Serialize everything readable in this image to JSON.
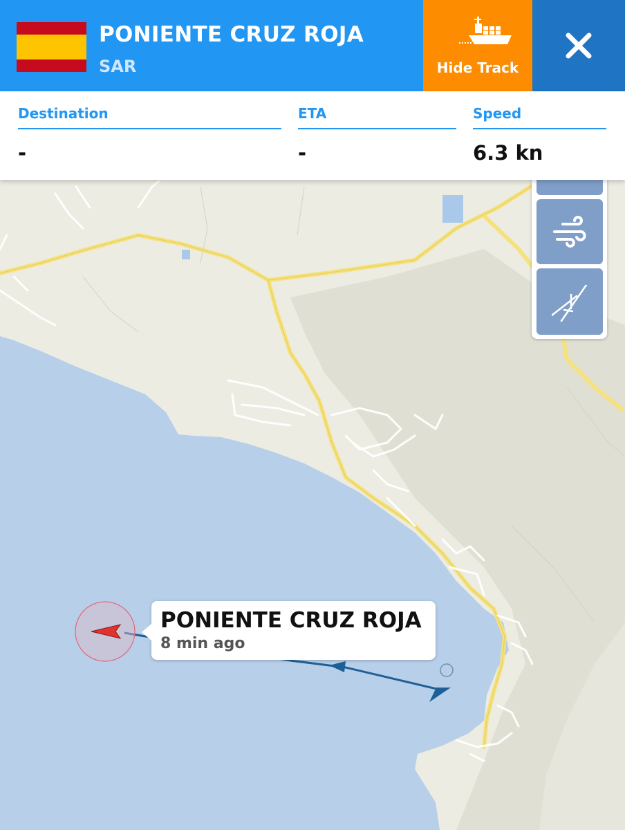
{
  "header": {
    "vessel_name": "PONIENTE CRUZ ROJA",
    "vessel_type": "SAR",
    "flag_icon": "spain-flag-icon",
    "hide_track_label": "Hide Track",
    "hide_track_icon": "cargo-ship-icon",
    "close_icon": "close-icon",
    "colors": {
      "header_bg": "#2196f3",
      "hide_track_bg": "#fd8c00",
      "close_bg": "#1f74c4"
    }
  },
  "info": {
    "destination": {
      "label": "Destination",
      "value": "-"
    },
    "eta": {
      "label": "ETA",
      "value": "-"
    },
    "speed": {
      "label": "Speed",
      "value": "6.3 kn"
    }
  },
  "map_controls": {
    "wind_icon": "wind-icon",
    "measure_icon": "measure-compass-icon"
  },
  "vessel_label": {
    "name": "PONIENTE CRUZ ROJA",
    "last_seen": "8 min ago"
  },
  "map": {
    "colors": {
      "sea": "#b7cfe9",
      "land": "#ecece3",
      "hills": "#dedfd2",
      "road": "#f5e27c",
      "track": "#1f5f97",
      "vessel_marker": "#e0322f"
    }
  }
}
